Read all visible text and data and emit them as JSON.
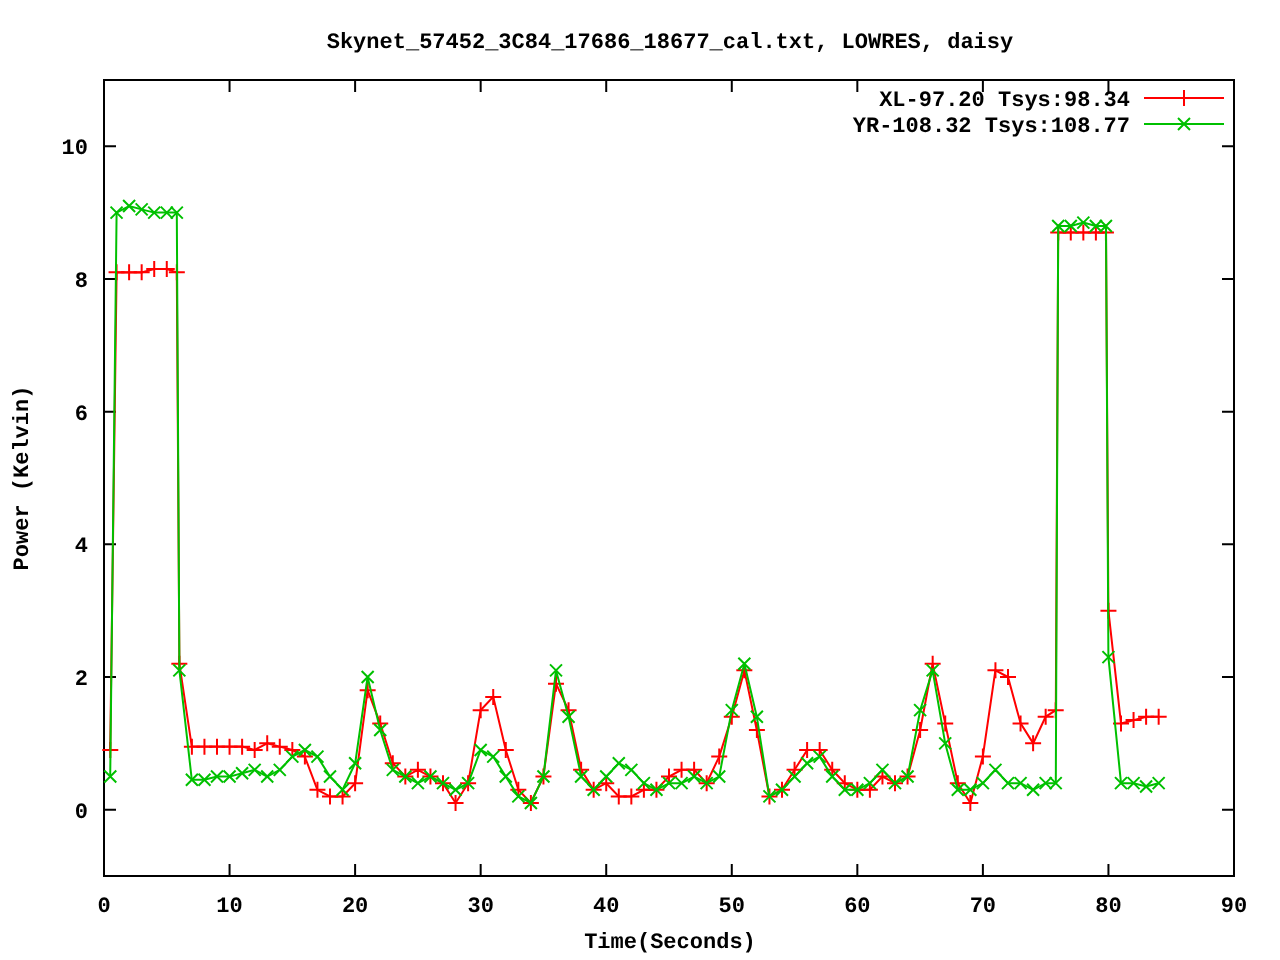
{
  "chart_data": {
    "type": "line",
    "title": "Skynet_57452_3C84_17686_18677_cal.txt, LOWRES, daisy",
    "xlabel": "Time(Seconds)",
    "ylabel": "Power (Kelvin)",
    "x": [
      0.5,
      1,
      2,
      3,
      4,
      5,
      5.8,
      6,
      7,
      8,
      9,
      10,
      11,
      12,
      13,
      14,
      15,
      16,
      17,
      18,
      19,
      20,
      21,
      22,
      23,
      24,
      25,
      26,
      27,
      28,
      29,
      30,
      31,
      32,
      33,
      34,
      35,
      36,
      37,
      38,
      39,
      40,
      41,
      42,
      43,
      44,
      45,
      46,
      47,
      48,
      49,
      50,
      51,
      52,
      53,
      54,
      55,
      56,
      57,
      58,
      59,
      60,
      61,
      62,
      63,
      64,
      65,
      66,
      67,
      68,
      69,
      70,
      71,
      72,
      73,
      74,
      75,
      75.8,
      76,
      77,
      78,
      79,
      79.8,
      80,
      81,
      82,
      83,
      84
    ],
    "series": [
      {
        "name": "XL-97.20 Tsys:98.34",
        "color": "#ff0000",
        "marker": "plus",
        "values": [
          0.9,
          8.1,
          8.1,
          8.1,
          8.15,
          8.15,
          8.1,
          2.2,
          0.95,
          0.95,
          0.95,
          0.95,
          0.95,
          0.9,
          1.0,
          0.95,
          0.9,
          0.8,
          0.3,
          0.2,
          0.2,
          0.4,
          1.8,
          1.3,
          0.7,
          0.5,
          0.6,
          0.5,
          0.4,
          0.1,
          0.4,
          1.5,
          1.7,
          0.9,
          0.3,
          0.1,
          0.5,
          1.9,
          1.5,
          0.6,
          0.3,
          0.4,
          0.2,
          0.2,
          0.3,
          0.3,
          0.5,
          0.6,
          0.6,
          0.4,
          0.8,
          1.4,
          2.1,
          1.2,
          0.2,
          0.3,
          0.6,
          0.9,
          0.9,
          0.6,
          0.4,
          0.3,
          0.3,
          0.5,
          0.4,
          0.5,
          1.2,
          2.2,
          1.3,
          0.4,
          0.1,
          0.8,
          2.1,
          2.0,
          1.3,
          1.0,
          1.4,
          1.5,
          8.7,
          8.7,
          8.7,
          8.7,
          8.7,
          3.0,
          1.3,
          1.35,
          1.4,
          1.4
        ]
      },
      {
        "name": "YR-108.32 Tsys:108.77",
        "color": "#00c000",
        "marker": "cross",
        "values": [
          0.5,
          9.0,
          9.1,
          9.05,
          9.0,
          9.0,
          9.0,
          2.1,
          0.45,
          0.45,
          0.5,
          0.5,
          0.55,
          0.6,
          0.5,
          0.6,
          0.8,
          0.9,
          0.8,
          0.5,
          0.3,
          0.7,
          2.0,
          1.2,
          0.6,
          0.5,
          0.4,
          0.5,
          0.4,
          0.3,
          0.4,
          0.9,
          0.8,
          0.5,
          0.2,
          0.1,
          0.5,
          2.1,
          1.4,
          0.5,
          0.3,
          0.5,
          0.7,
          0.6,
          0.4,
          0.3,
          0.4,
          0.4,
          0.5,
          0.4,
          0.5,
          1.5,
          2.2,
          1.4,
          0.2,
          0.3,
          0.5,
          0.7,
          0.8,
          0.5,
          0.3,
          0.3,
          0.4,
          0.6,
          0.4,
          0.5,
          1.5,
          2.1,
          1.0,
          0.3,
          0.3,
          0.4,
          0.6,
          0.4,
          0.4,
          0.3,
          0.4,
          0.4,
          8.8,
          8.8,
          8.85,
          8.8,
          8.8,
          2.3,
          0.4,
          0.4,
          0.35,
          0.4
        ]
      }
    ],
    "xlim": [
      0,
      90
    ],
    "ylim": [
      -1,
      11
    ],
    "xticks": [
      0,
      10,
      20,
      30,
      40,
      50,
      60,
      70,
      80,
      90
    ],
    "yticks": [
      0,
      2,
      4,
      6,
      8,
      10
    ],
    "legend": true
  }
}
